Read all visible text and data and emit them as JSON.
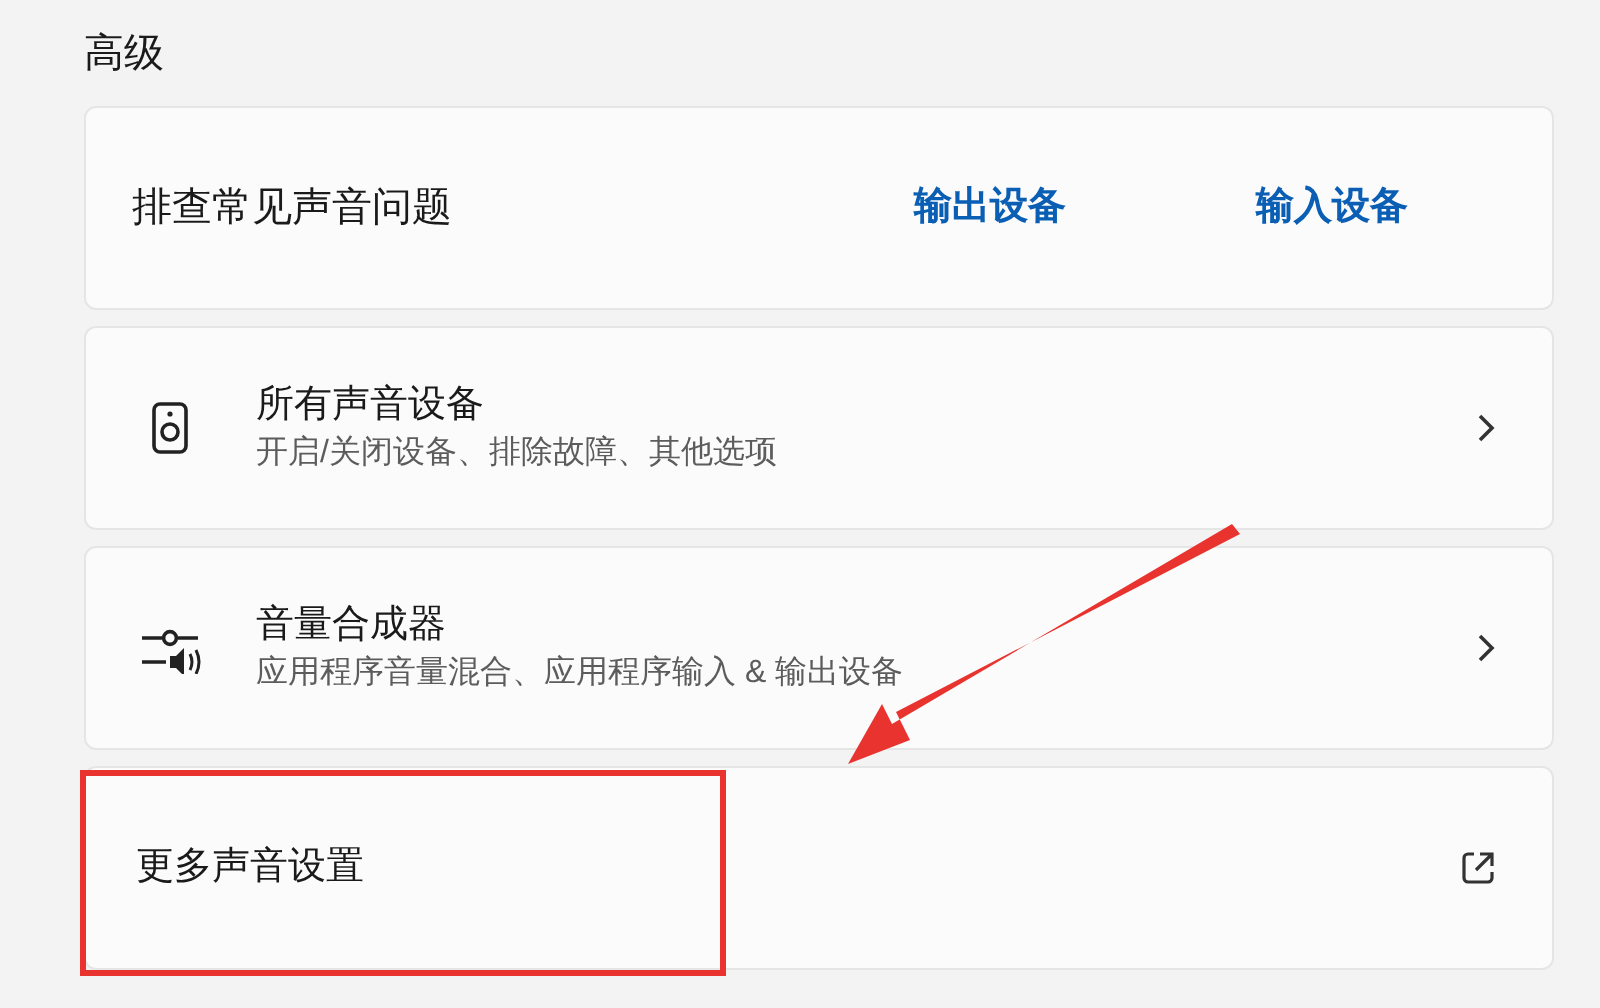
{
  "section_title": "高级",
  "troubleshoot": {
    "label": "排查常见声音问题",
    "links": [
      "输出设备",
      "输入设备"
    ]
  },
  "items": [
    {
      "kind": "devices",
      "title": "所有声音设备",
      "subtitle": "开启/关闭设备、排除故障、其他选项",
      "trailing_icon": {
        "kind": "chevron"
      }
    },
    {
      "kind": "mixer",
      "title": "音量合成器",
      "subtitle": "应用程序音量混合、应用程序输入 & 输出设备",
      "trailing_icon": {
        "kind": "chevron"
      }
    },
    {
      "kind": "plain",
      "title": "更多声音设置",
      "trailing_icon": {
        "kind": "external"
      }
    }
  ],
  "highlight_box": true,
  "red_arrow": true
}
